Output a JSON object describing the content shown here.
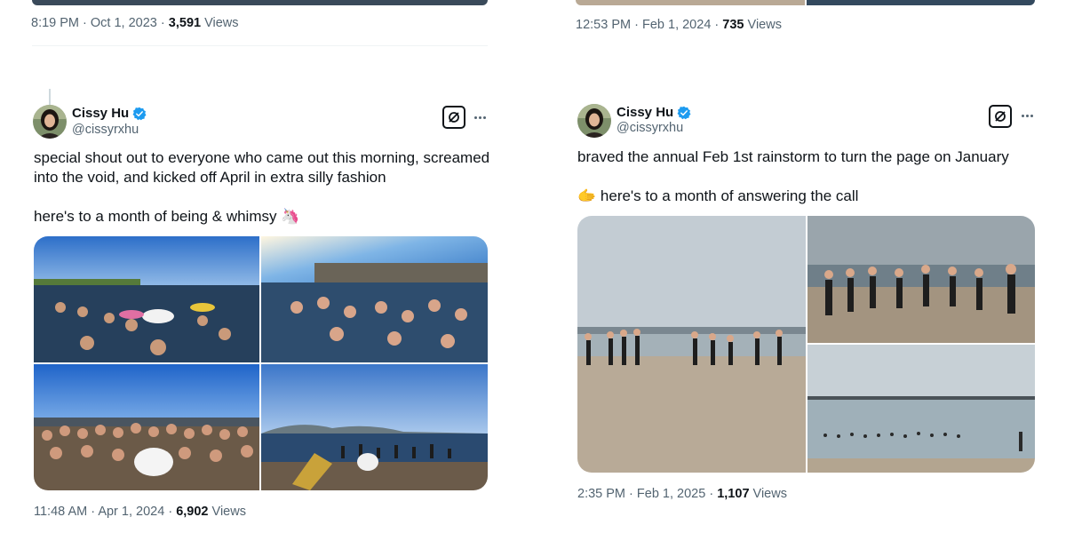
{
  "prev_left": {
    "time": "8:19 PM",
    "date": "Oct 1, 2023",
    "views_count": "3,591",
    "views_label": "Views"
  },
  "prev_right": {
    "time": "12:53 PM",
    "date": "Feb 1, 2024",
    "views_count": "735",
    "views_label": "Views"
  },
  "tweet_left": {
    "name": "Cissy Hu",
    "handle": "@cissyrxhu",
    "line1": "special shout out to everyone who came out this morning, screamed into the void, and kicked off April in extra silly fashion",
    "line2": "here's to a month of being & whimsy",
    "line2_emoji": "🦄",
    "time": "11:48 AM",
    "date": "Apr 1, 2024",
    "views_count": "6,902",
    "views_label": "Views",
    "images": [
      "people swimming with unicorn floatie",
      "swimmers cheering in bay",
      "group photo on beach",
      "swimmers entering water at sunrise"
    ]
  },
  "tweet_right": {
    "name": "Cissy Hu",
    "handle": "@cissyrxhu",
    "line1": "braved the annual Feb 1st rainstorm to turn the page on January",
    "line2_emoji": "🫱",
    "line2": "here's to a month of answering the call",
    "time": "2:35 PM",
    "date": "Feb 1, 2025",
    "views_count": "1,107",
    "views_label": "Views",
    "images": [
      "runners on beach",
      "runners heading into water",
      "swimmers near pier"
    ]
  },
  "icons": {
    "verified": "verified-badge-icon",
    "grok": "grok-icon",
    "more": "more-icon"
  },
  "colors": {
    "text": "#0f1419",
    "secondary": "#536471",
    "verified": "#1d9bf0",
    "divider": "#eff3f4"
  },
  "separator": "·"
}
